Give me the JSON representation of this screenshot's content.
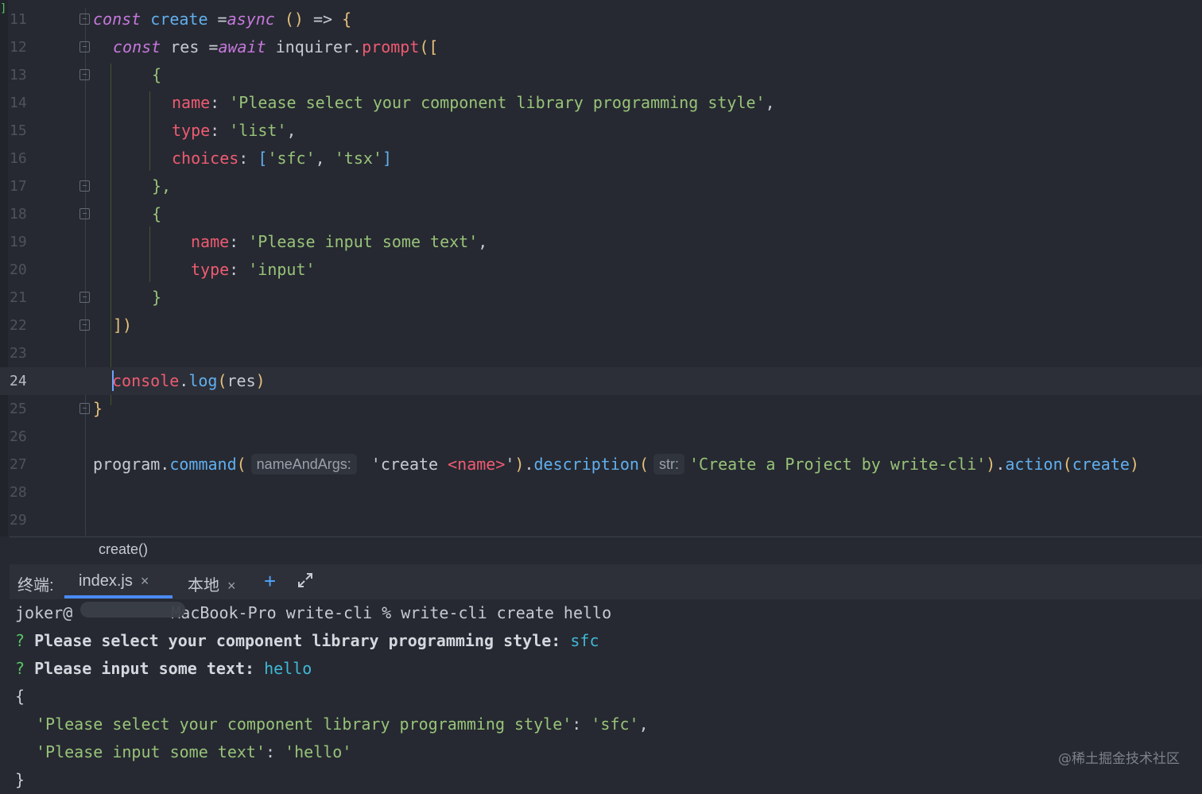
{
  "editor": {
    "lines": [
      {
        "n": "11"
      },
      {
        "n": "12"
      },
      {
        "n": "13"
      },
      {
        "n": "14"
      },
      {
        "n": "15"
      },
      {
        "n": "16"
      },
      {
        "n": "17"
      },
      {
        "n": "18"
      },
      {
        "n": "19"
      },
      {
        "n": "20"
      },
      {
        "n": "21"
      },
      {
        "n": "22"
      },
      {
        "n": "23"
      },
      {
        "n": "24"
      },
      {
        "n": "25"
      },
      {
        "n": "26"
      },
      {
        "n": "27"
      },
      {
        "n": "28"
      },
      {
        "n": "29"
      }
    ],
    "tokens": {
      "l11": {
        "kw1": "const",
        "name": "create",
        "eq": " =",
        "kw2": "async",
        "parens": " ()",
        "arrow": " => ",
        "brace": "{"
      },
      "l12": {
        "kw1": "const",
        "var": " res =",
        "kw2": "await",
        "obj": " inquirer.",
        "fn": "prompt",
        "open": "(["
      },
      "l13": {
        "brace": "{"
      },
      "l14": {
        "key": "name",
        "colon": ": ",
        "val": "'Please select your component library programming style'",
        "comma": ","
      },
      "l15": {
        "key": "type",
        "colon": ": ",
        "val": "'list'",
        "comma": ","
      },
      "l16": {
        "key": "choices",
        "colon": ": ",
        "lb": "[",
        "v1": "'sfc'",
        "sep": ", ",
        "v2": "'tsx'",
        "rb": "]"
      },
      "l17": {
        "brace": "},"
      },
      "l18": {
        "brace": "{"
      },
      "l19": {
        "key": "name",
        "colon": ": ",
        "val": "'Please input some text'",
        "comma": ","
      },
      "l20": {
        "key": "type",
        "colon": ": ",
        "val": "'input'"
      },
      "l21": {
        "brace": "}"
      },
      "l22": {
        "close": "])"
      },
      "l24": {
        "obj": "console",
        "dot": ".",
        "fn": "log",
        "open": "(",
        "arg": "res",
        "close": ")"
      },
      "l25": {
        "brace": "}"
      },
      "l27": {
        "obj": "program.",
        "fn1": "command",
        "open1": "(",
        "hint1": "nameAndArgs:",
        "s1a": " 'create ",
        "s1b": "<name>",
        "s1c": "'",
        "close1": ")",
        "dot": ".",
        "fn2": "description",
        "open2": "(",
        "hint2": "str:",
        "s2": "'Create a Project by write-cli'",
        "close2": ")",
        "dot2": ".",
        "fn3": "action",
        "open3": "(",
        "arg3": "create",
        "close3": ")"
      }
    }
  },
  "breadcrumb": "create()",
  "terminal": {
    "label": "终端:",
    "tabs": [
      {
        "label": "index.js",
        "close": "×"
      },
      {
        "label": "本地",
        "close": "×"
      }
    ],
    "add": "+",
    "lines": {
      "prompt_a": "joker@",
      "prompt_b": "MacBook-Pro write-cli % write-cli create hello",
      "q1_mark": "?",
      "q1_text": " Please select your component library programming style: ",
      "q1_ans": "sfc",
      "q2_mark": "?",
      "q2_text": " Please input some text: ",
      "q2_ans": "hello",
      "open": "{",
      "o1_key": "'Please select your component library programming style'",
      "o1_sep": ": ",
      "o1_val": "'sfc'",
      "o1_comma": ",",
      "o2_key": "'Please input some text'",
      "o2_sep": ": ",
      "o2_val": "'hello'",
      "close": "}"
    }
  },
  "watermark": "@稀土掘金技术社区"
}
